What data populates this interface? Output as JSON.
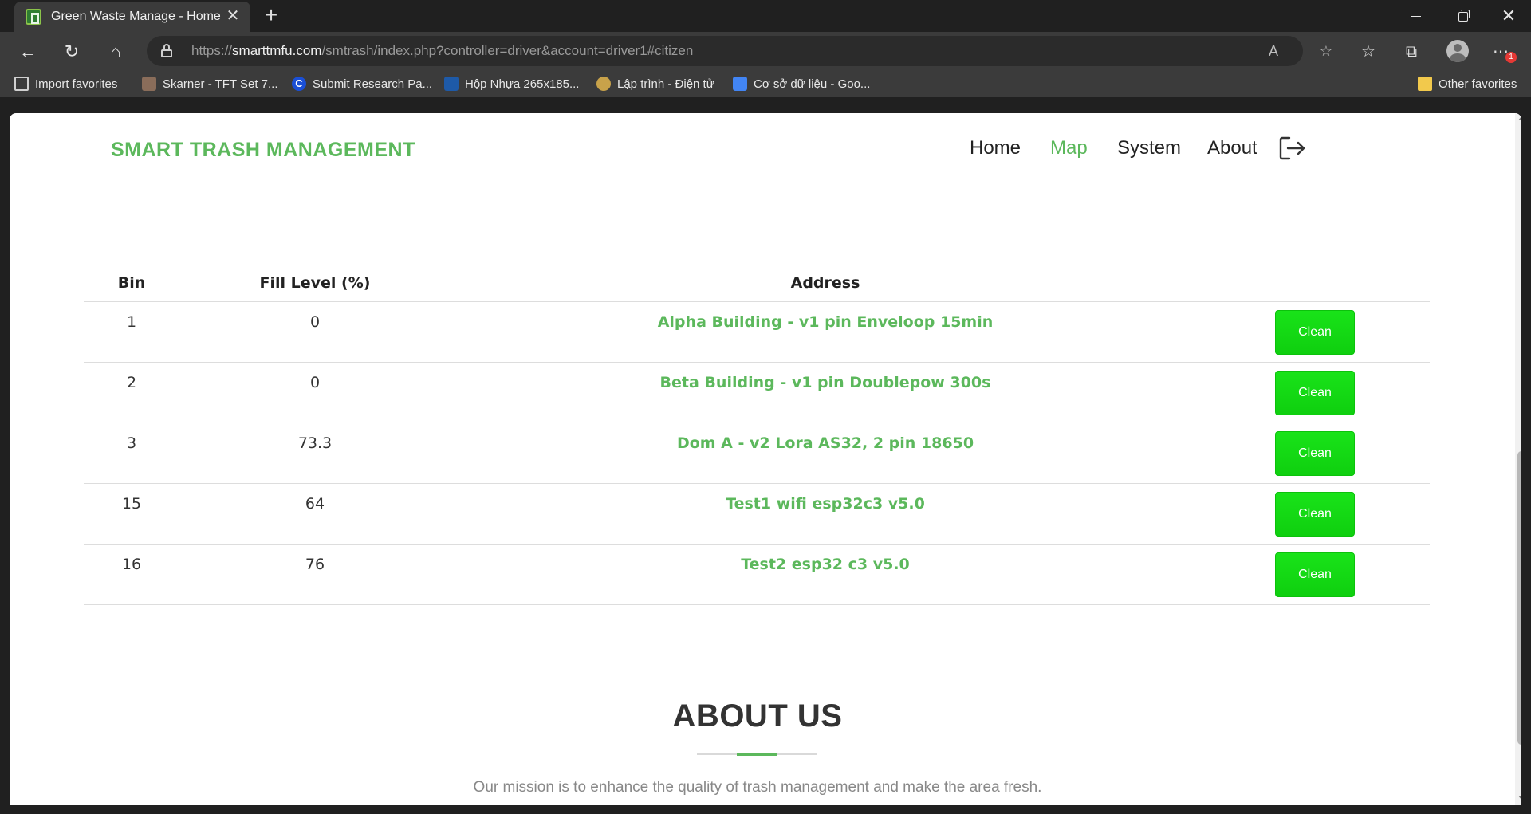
{
  "browser": {
    "tab_title": "Green Waste Manage - Home",
    "url_scheme": "https://",
    "url_host": "smarttmfu.com",
    "url_path": "/smtrash/index.php?controller=driver&account=driver1#citizen",
    "notification_count": "1",
    "favorites": [
      {
        "label": "Import favorites",
        "icon": "import-icon"
      },
      {
        "label": "Skarner - TFT Set 7...",
        "icon": "game-icon"
      },
      {
        "label": "Submit Research Pa...",
        "icon": "c-icon"
      },
      {
        "label": "Hộp Nhựa 265x185...",
        "icon": "shop-icon"
      },
      {
        "label": "Lập trình - Điện tử",
        "icon": "chip-icon"
      },
      {
        "label": "Cơ sở dữ liệu - Goo...",
        "icon": "docs-icon"
      },
      {
        "label": "Other favorites",
        "icon": "folder-icon"
      }
    ]
  },
  "site": {
    "brand": "SMART TRASH MANAGEMENT",
    "nav": {
      "home": "Home",
      "map": "Map",
      "system": "System",
      "about": "About"
    },
    "accent_color": "#5cb85c",
    "button_color": "#19e319"
  },
  "table": {
    "headers": {
      "bin": "Bin",
      "fill": "Fill Level (%)",
      "address": "Address"
    },
    "rows": [
      {
        "bin": "1",
        "fill": "0",
        "address": "Alpha Building - v1 pin Enveloop 15min",
        "action": "Clean"
      },
      {
        "bin": "2",
        "fill": "0",
        "address": "Beta Building - v1 pin Doublepow 300s",
        "action": "Clean"
      },
      {
        "bin": "3",
        "fill": "73.3",
        "address": "Dom A - v2 Lora AS32, 2 pin 18650",
        "action": "Clean"
      },
      {
        "bin": "15",
        "fill": "64",
        "address": "Test1 wifi esp32c3 v5.0",
        "action": "Clean"
      },
      {
        "bin": "16",
        "fill": "76",
        "address": "Test2 esp32 c3 v5.0",
        "action": "Clean"
      }
    ]
  },
  "about": {
    "title": "ABOUT US",
    "text": "Our mission is to enhance the quality of trash management and make the area fresh."
  }
}
